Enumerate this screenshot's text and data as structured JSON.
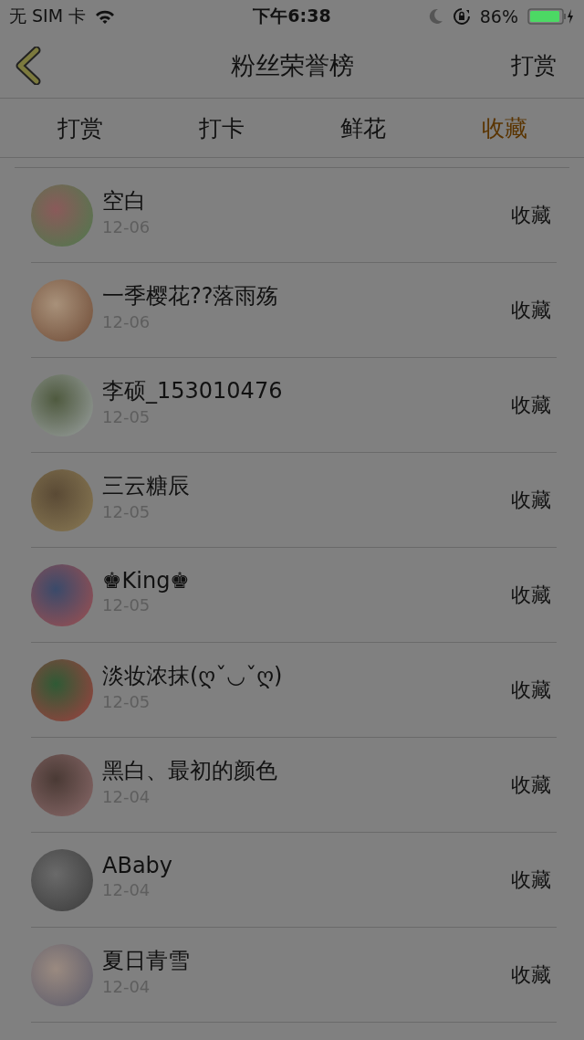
{
  "status_bar": {
    "carrier": "无 SIM 卡",
    "time": "下午6:38",
    "battery": "86%"
  },
  "nav": {
    "title": "粉丝荣誉榜",
    "action": "打赏"
  },
  "tabs": [
    {
      "label": "打赏",
      "selected": false
    },
    {
      "label": "打卡",
      "selected": false
    },
    {
      "label": "鲜花",
      "selected": false
    },
    {
      "label": "收藏",
      "selected": true
    }
  ],
  "rows": [
    {
      "name": "空白",
      "date": "12-06",
      "type": "收藏"
    },
    {
      "name": "一季樱花??落雨殇",
      "date": "12-06",
      "type": "收藏"
    },
    {
      "name": "李硕_153010476",
      "date": "12-05",
      "type": "收藏"
    },
    {
      "name": "三云糖辰",
      "date": "12-05",
      "type": "收藏"
    },
    {
      "name": "♚King♚",
      "date": "12-05",
      "type": "收藏"
    },
    {
      "name": "淡妆浓抹(ღˇ◡ˇღ)",
      "date": "12-05",
      "type": "收藏"
    },
    {
      "name": "黑白、最初的颜色",
      "date": "12-04",
      "type": "收藏"
    },
    {
      "name": "ABaby",
      "date": "12-04",
      "type": "收藏"
    },
    {
      "name": "夏日青雪",
      "date": "12-04",
      "type": "收藏"
    }
  ]
}
